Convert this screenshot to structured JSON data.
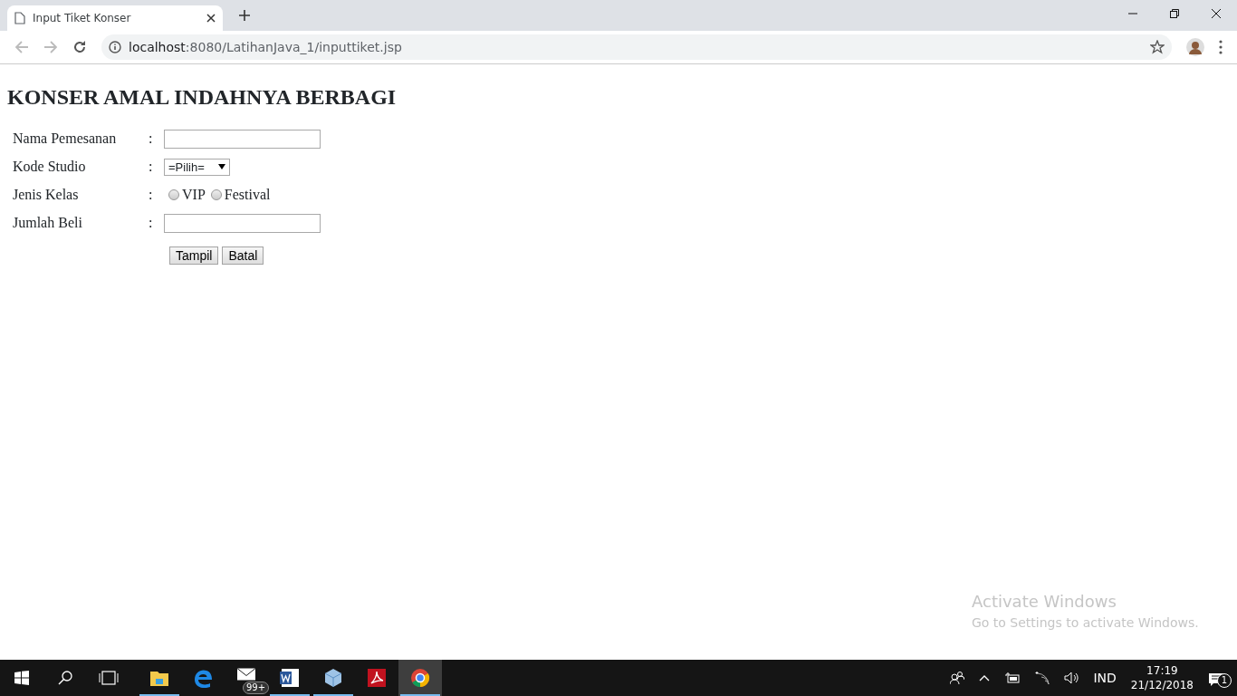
{
  "browser": {
    "tab": {
      "title": "Input Tiket Konser",
      "selected": true
    },
    "url_host": "localhost",
    "url_path": ":8080/LatihanJava_1/inputtiket.jsp"
  },
  "page": {
    "heading": "KONSER AMAL INDAHNYA BERBAGI",
    "fields": [
      {
        "kind": "text",
        "label": "Nama Pemesanan",
        "separator": ":"
      },
      {
        "kind": "select",
        "label": "Kode Studio",
        "separator": ":",
        "value": "=Pilih="
      },
      {
        "kind": "radio",
        "label": "Jenis Kelas",
        "separator": ":",
        "options": [
          {
            "label": "VIP",
            "selected": false
          },
          {
            "label": "Festival",
            "selected": false
          }
        ]
      },
      {
        "kind": "text",
        "label": "Jumlah Beli",
        "separator": ":"
      }
    ],
    "buttons": [
      "Tampil",
      "Batal"
    ]
  },
  "activation_notice": {
    "title": "Activate Windows",
    "subtitle": "Go to Settings to activate Windows."
  },
  "taskbar": {
    "apps": [
      {
        "kind": "explorer",
        "running": true,
        "active": false
      },
      {
        "kind": "edge",
        "running": false,
        "active": false
      },
      {
        "kind": "mail",
        "running": false,
        "active": false,
        "badge": "99+"
      },
      {
        "kind": "word",
        "running": true,
        "active": false
      },
      {
        "kind": "cube",
        "running": true,
        "active": false
      },
      {
        "kind": "pdf",
        "running": false,
        "active": false
      },
      {
        "kind": "chrome",
        "running": true,
        "active": true
      }
    ],
    "language": "IND",
    "time": "17:19",
    "date": "21/12/2018",
    "notification_count": "1"
  }
}
